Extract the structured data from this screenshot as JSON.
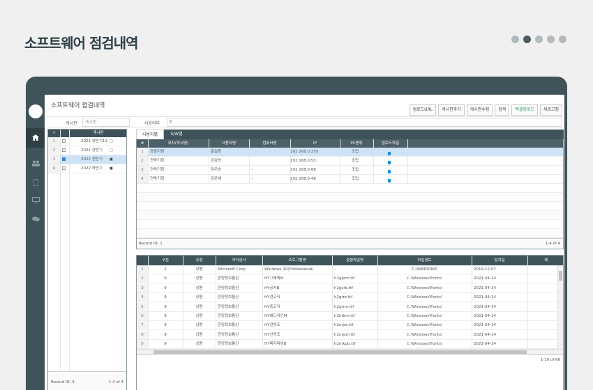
{
  "page": {
    "title": "소프트웨어 점검내역",
    "pager_dots": 5,
    "active_dot": 2
  },
  "app": {
    "title": "소프트웨어 점검내역",
    "toolbar": [
      "업로드URL",
      "게시판추가",
      "게시판수정",
      "검색",
      "엑셀업로드",
      "새로고침"
    ],
    "nav_icons": [
      "home-icon",
      "users-icon",
      "document-icon",
      "monitor-icon",
      "chat-icon"
    ],
    "filter": {
      "board_label": "게시판",
      "board_placeholder": "게시판",
      "use_label": "사용여부",
      "use_value": "Y"
    }
  },
  "board_grid": {
    "header": {
      "num": "#",
      "board": "게시판"
    },
    "rows": [
      {
        "num": "1",
        "label": "2021 상반기11",
        "checked": false,
        "locked": false,
        "selected": false
      },
      {
        "num": "2",
        "label": "2021 상반기",
        "checked": false,
        "locked": false,
        "selected": false
      },
      {
        "num": "3",
        "label": "2022 전반기",
        "checked": true,
        "locked": true,
        "selected": true
      },
      {
        "num": "4",
        "label": "2022 하반기",
        "checked": false,
        "locked": true,
        "selected": false
      }
    ],
    "footer_left": "Record ID: 3",
    "footer_right": "1-4 of 4"
  },
  "tabs": [
    "사용자별",
    "S/W별"
  ],
  "user_grid": {
    "headers": [
      "#",
      "회사(부서명)",
      "사용자명",
      "컴퓨터명",
      "IP",
      "PC종류",
      "업로드파일"
    ],
    "rows": [
      {
        "num": "1",
        "dept": "경영지원",
        "user": "홍길동",
        "pc": "",
        "ip": "192.168.0.255",
        "type": "조립",
        "selected": true
      },
      {
        "num": "2",
        "dept": "전략기획",
        "user": "강감찬",
        "pc": "",
        "ip": "192.168.0.53",
        "type": "조립",
        "selected": false
      },
      {
        "num": "3",
        "dept": "전략기획",
        "user": "정우송",
        "pc": "-",
        "ip": "192.168.0.68",
        "type": "조립",
        "selected": false
      },
      {
        "num": "4",
        "dept": "전략기획",
        "user": "김은혜",
        "pc": "-",
        "ip": "192.168.0.48",
        "type": "조립",
        "selected": false
      }
    ],
    "footer_left": "Record ID: 1",
    "footer_right": "1-4 of 4"
  },
  "sw_grid": {
    "headers": [
      "",
      "구분",
      "유형",
      "저작권사",
      "프로그램명",
      "실행파일명",
      "파일경로",
      "설치일",
      "제"
    ],
    "rows": [
      {
        "num": "1",
        "cat": "1",
        "kind": "상용",
        "owner": "Microsoft Corp.",
        "prog": "Windows 10(Professional)",
        "exe": "-",
        "path": "C:\\WINDOWS",
        "date": "2019-12-07"
      },
      {
        "num": "2",
        "cat": "9",
        "kind": "상용",
        "owner": "한양정보통신",
        "prog": "HY그래픽M",
        "exe": "h2gprm.ttf",
        "path": "C:\\Windows\\Fonts\\",
        "date": "2021-04-14"
      },
      {
        "num": "3",
        "cat": "9",
        "kind": "상용",
        "owner": "한양정보통신",
        "prog": "HY궁서B",
        "exe": "h2gsrb.ttf",
        "path": "C:\\Windows\\Fonts\\",
        "date": "2021-04-14"
      },
      {
        "num": "4",
        "cat": "9",
        "kind": "상용",
        "owner": "한양정보통신",
        "prog": "HY견고딕",
        "exe": "h2gtre.ttf",
        "path": "C:\\Windows\\Fonts\\",
        "date": "2021-04-14"
      },
      {
        "num": "5",
        "cat": "9",
        "kind": "상용",
        "owner": "한양정보통신",
        "prog": "HY중고딕",
        "exe": "h2gtrm.ttf",
        "path": "C:\\Windows\\Fonts\\",
        "date": "2021-04-14"
      },
      {
        "num": "6",
        "cat": "9",
        "kind": "상용",
        "owner": "한양정보통신",
        "prog": "HY헤드라인M",
        "exe": "h2hdrm.ttf",
        "path": "C:\\Windows\\Fonts\\",
        "date": "2021-04-14"
      },
      {
        "num": "7",
        "cat": "9",
        "kind": "상용",
        "owner": "한양정보통신",
        "prog": "HY견명조",
        "exe": "h2mjre.ttf",
        "path": "C:\\Windows\\Fonts\\",
        "date": "2021-04-14"
      },
      {
        "num": "8",
        "cat": "9",
        "kind": "상용",
        "owner": "한양정보통신",
        "prog": "HY신명조",
        "exe": "h2mjsm.ttf",
        "path": "C:\\Windows\\Fonts\\",
        "date": "2021-04-14"
      },
      {
        "num": "9",
        "cat": "9",
        "kind": "상용",
        "owner": "한양정보통신",
        "prog": "HY목각파임B",
        "exe": "h2mkpb.ttf",
        "path": "C:\\Windows\\Fonts\\",
        "date": "2021-04-14"
      }
    ],
    "footer_right": "1-10 of 66"
  }
}
